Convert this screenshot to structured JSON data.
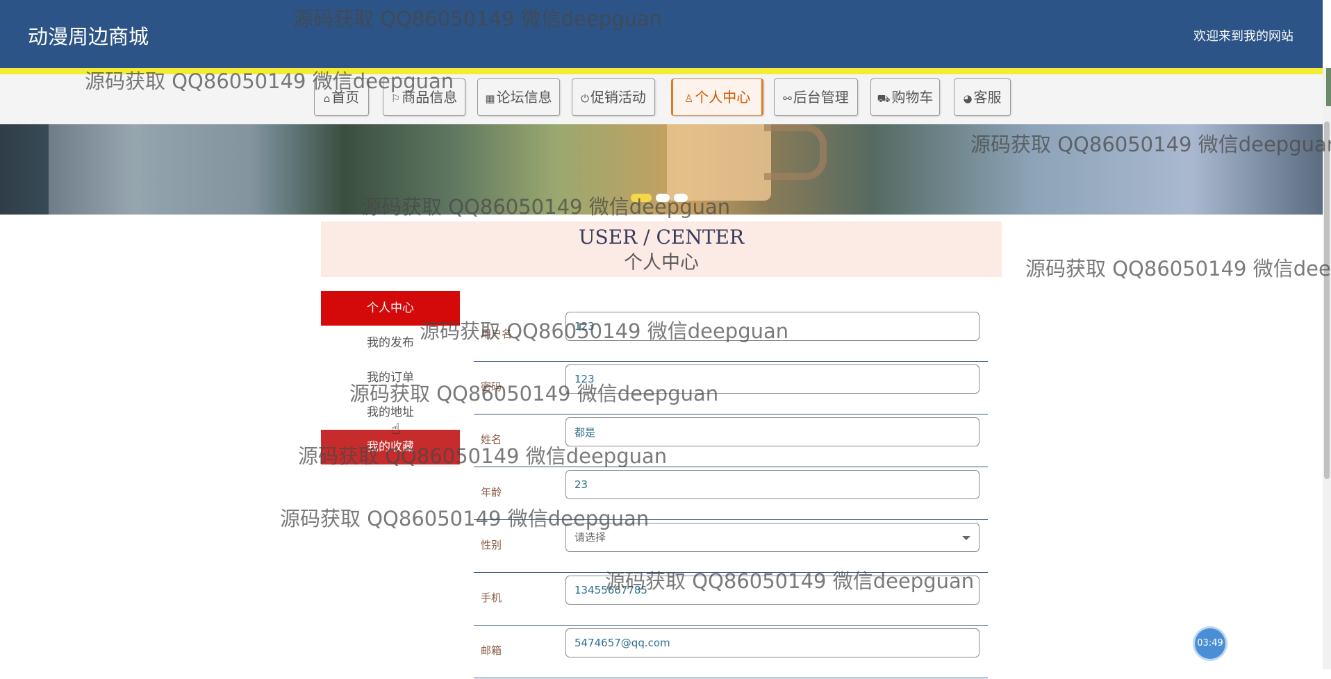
{
  "header": {
    "title": "动漫周边商城",
    "welcome": "欢迎来到我的网站"
  },
  "nav": {
    "items": [
      {
        "icon": "⌂",
        "label": "首页",
        "icon_name": "home-icon"
      },
      {
        "icon": "⚐",
        "label": "商品信息",
        "icon_name": "flag-icon"
      },
      {
        "icon": "▦",
        "label": "论坛信息",
        "icon_name": "grid-icon"
      },
      {
        "icon": "⏻",
        "label": "促销活动",
        "icon_name": "power-icon"
      },
      {
        "icon": "♙",
        "label": "个人中心",
        "icon_name": "user-icon"
      },
      {
        "icon": "⚯",
        "label": "后台管理",
        "icon_name": "link-icon"
      },
      {
        "icon": "⛟",
        "label": "购物车",
        "icon_name": "cart-icon"
      },
      {
        "icon": "◕",
        "label": "客服",
        "icon_name": "headset-icon"
      }
    ],
    "active_index": 4
  },
  "banner": {
    "dots": 3,
    "active_dot": 0
  },
  "center": {
    "title_en": "USER / CENTER",
    "title_zh": "个人中心"
  },
  "side_menu": {
    "items": [
      {
        "label": "个人中心"
      },
      {
        "label": "我的发布"
      },
      {
        "label": "我的订单"
      },
      {
        "label": "我的地址"
      },
      {
        "label": "我的收藏"
      }
    ],
    "active_index": 0,
    "hover_index": 4
  },
  "form": {
    "fields": [
      {
        "label": "用户名",
        "value": "123"
      },
      {
        "label": "密码",
        "value": "123"
      },
      {
        "label": "姓名",
        "value": "都是"
      },
      {
        "label": "年龄",
        "value": "23"
      },
      {
        "label": "性别",
        "value": "请选择",
        "type": "select"
      },
      {
        "label": "手机",
        "value": "13455667785"
      },
      {
        "label": "邮箱",
        "value": "5474657@qq.com"
      }
    ]
  },
  "timer": {
    "text": "03:49"
  },
  "watermark": {
    "text": "源码获取 QQ86050149 微信deepguan"
  },
  "colors": {
    "header_bg": "#2d5487",
    "accent_red": "#d40a0a",
    "active_nav": "#d35400"
  }
}
